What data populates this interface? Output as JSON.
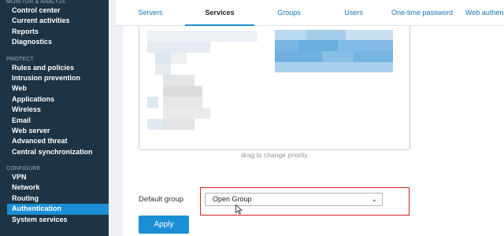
{
  "sidebar": {
    "sections": [
      {
        "title": "MONITOR & ANALYZE",
        "items": [
          "Control center",
          "Current activities",
          "Reports",
          "Diagnostics"
        ]
      },
      {
        "title": "PROTECT",
        "items": [
          "Rules and policies",
          "Intrusion prevention",
          "Web",
          "Applications",
          "Wireless",
          "Email",
          "Web server",
          "Advanced threat",
          "Central synchronization"
        ]
      },
      {
        "title": "CONFIGURE",
        "items": [
          "VPN",
          "Network",
          "Routing",
          "Authentication",
          "System services"
        ]
      }
    ],
    "active_item": "Authentication"
  },
  "tabs": [
    "Servers",
    "Services",
    "Groups",
    "Users",
    "One-time password",
    "Web authen"
  ],
  "active_tab": "Services",
  "main": {
    "drag_hint": "drag to change priority",
    "default_group_label": "Default group",
    "default_group_value": "Open Group",
    "apply_label": "Apply"
  },
  "colors": {
    "sidebar": "#1e3343",
    "accent": "#1b8fd6",
    "highlight": "#d2232a"
  }
}
